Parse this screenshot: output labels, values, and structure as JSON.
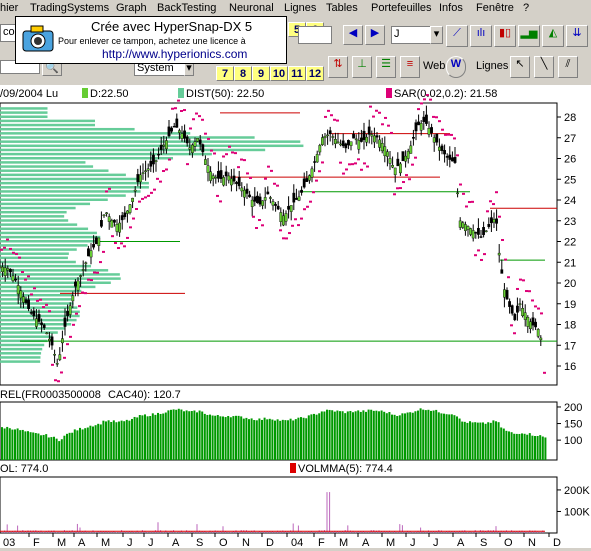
{
  "menu": [
    "hier",
    "TradingSystems",
    "Graph",
    "BackTesting",
    "Neuronal",
    "Lignes",
    "Tables",
    "Portefeuilles",
    "Infos",
    "Fenêtre",
    "?"
  ],
  "toolbar": {
    "symbol_field": "J",
    "left_label": "cor",
    "system_label": "System",
    "numbers_top": [
      "5",
      "6"
    ],
    "numbers_bottom": [
      "7",
      "8",
      "9",
      "10",
      "11",
      "12"
    ],
    "web_label": "Web",
    "lines_label": "Lignes"
  },
  "stamp": {
    "title": "Crée avec HyperSnap-DX 5",
    "line2": "Pour enlever ce tampon, achetez une licence à",
    "url": "http://www.hyperionics.com"
  },
  "price_panel": {
    "date_label": "/09/2004 Lu",
    "d_label": "D:22.50",
    "dist_label": "DIST(50): 22.50",
    "sar_label": "SAR(0.02,0.2): 21.58",
    "colors": {
      "d": "#66cc33",
      "dist": "#66cc99",
      "sar": "#dd0077"
    }
  },
  "rel_panel": {
    "label": "REL(FR0003500008",
    "cac_label": "CAC40): 120.7"
  },
  "vol_panel": {
    "label": "OL: 774.0",
    "volma_label": "VOLMMA(5): 774.4"
  },
  "x_axis_labels": [
    "03",
    "F",
    "M",
    "A",
    "M",
    "J",
    "J",
    "A",
    "S",
    "O",
    "N",
    "D",
    "04",
    "F",
    "M",
    "A",
    "M",
    "J",
    "J",
    "A",
    "S",
    "O",
    "N",
    "D"
  ],
  "chart_data": {
    "type": "candlestick",
    "price_axis": {
      "ylim": [
        15,
        28.7
      ],
      "ticks": [
        "28",
        "27",
        "26",
        "25",
        "24",
        "23",
        "22",
        "21",
        "20",
        "19",
        "18",
        "17",
        "16"
      ]
    },
    "rel_axis": {
      "ticks": [
        "200",
        "150",
        "100"
      ]
    },
    "vol_axis": {
      "ticks": [
        "200K",
        "100K"
      ]
    },
    "last_close": 22.5,
    "sar_last": 21.58,
    "rel_last": 120.7,
    "vol_last": 774.0,
    "volma_last": 774.4,
    "price_path": [
      [
        0,
        20.8
      ],
      [
        8,
        20.7
      ],
      [
        15,
        20.2
      ],
      [
        22,
        19.5
      ],
      [
        30,
        18.6
      ],
      [
        38,
        18.2
      ],
      [
        45,
        17.8
      ],
      [
        52,
        17.0
      ],
      [
        58,
        16.0
      ],
      [
        63,
        17.5
      ],
      [
        68,
        18.5
      ],
      [
        75,
        19.8
      ],
      [
        82,
        20.5
      ],
      [
        90,
        21.5
      ],
      [
        98,
        22.0
      ],
      [
        105,
        23.5
      ],
      [
        112,
        23.0
      ],
      [
        118,
        22.8
      ],
      [
        125,
        23.2
      ],
      [
        132,
        24.0
      ],
      [
        140,
        25.2
      ],
      [
        148,
        25.5
      ],
      [
        155,
        25.8
      ],
      [
        162,
        26.5
      ],
      [
        168,
        27.0
      ],
      [
        175,
        27.6
      ],
      [
        182,
        27.2
      ],
      [
        190,
        26.5
      ],
      [
        198,
        27.0
      ],
      [
        205,
        26.0
      ],
      [
        212,
        25.2
      ],
      [
        220,
        25.0
      ],
      [
        228,
        25.2
      ],
      [
        236,
        24.8
      ],
      [
        244,
        24.5
      ],
      [
        252,
        24.0
      ],
      [
        260,
        23.8
      ],
      [
        268,
        24.3
      ],
      [
        276,
        23.7
      ],
      [
        284,
        23.2
      ],
      [
        292,
        23.8
      ],
      [
        300,
        24.2
      ],
      [
        308,
        25.0
      ],
      [
        316,
        26.0
      ],
      [
        322,
        27.0
      ],
      [
        330,
        27.2
      ],
      [
        338,
        26.8
      ],
      [
        346,
        26.5
      ],
      [
        354,
        27.0
      ],
      [
        362,
        26.8
      ],
      [
        370,
        27.2
      ],
      [
        378,
        27.0
      ],
      [
        386,
        26.5
      ],
      [
        394,
        25.5
      ],
      [
        402,
        25.8
      ],
      [
        410,
        26.5
      ],
      [
        418,
        27.6
      ],
      [
        425,
        27.8
      ],
      [
        432,
        27.2
      ],
      [
        440,
        26.5
      ],
      [
        448,
        26.0
      ],
      [
        455,
        25.8
      ],
      [
        460,
        23.0
      ],
      [
        466,
        22.8
      ],
      [
        474,
        22.5
      ],
      [
        482,
        22.2
      ],
      [
        490,
        22.8
      ],
      [
        496,
        23.2
      ],
      [
        500,
        21.0
      ],
      [
        505,
        19.5
      ],
      [
        510,
        18.8
      ],
      [
        515,
        18.2
      ],
      [
        520,
        19.0
      ],
      [
        526,
        18.5
      ],
      [
        532,
        18.0
      ],
      [
        538,
        17.8
      ],
      [
        543,
        17.0
      ]
    ],
    "horizontal_levels": [
      28.2,
      27.2,
      25.1,
      24.4,
      23.6,
      22.0,
      21.1,
      19.5,
      17.2
    ]
  }
}
